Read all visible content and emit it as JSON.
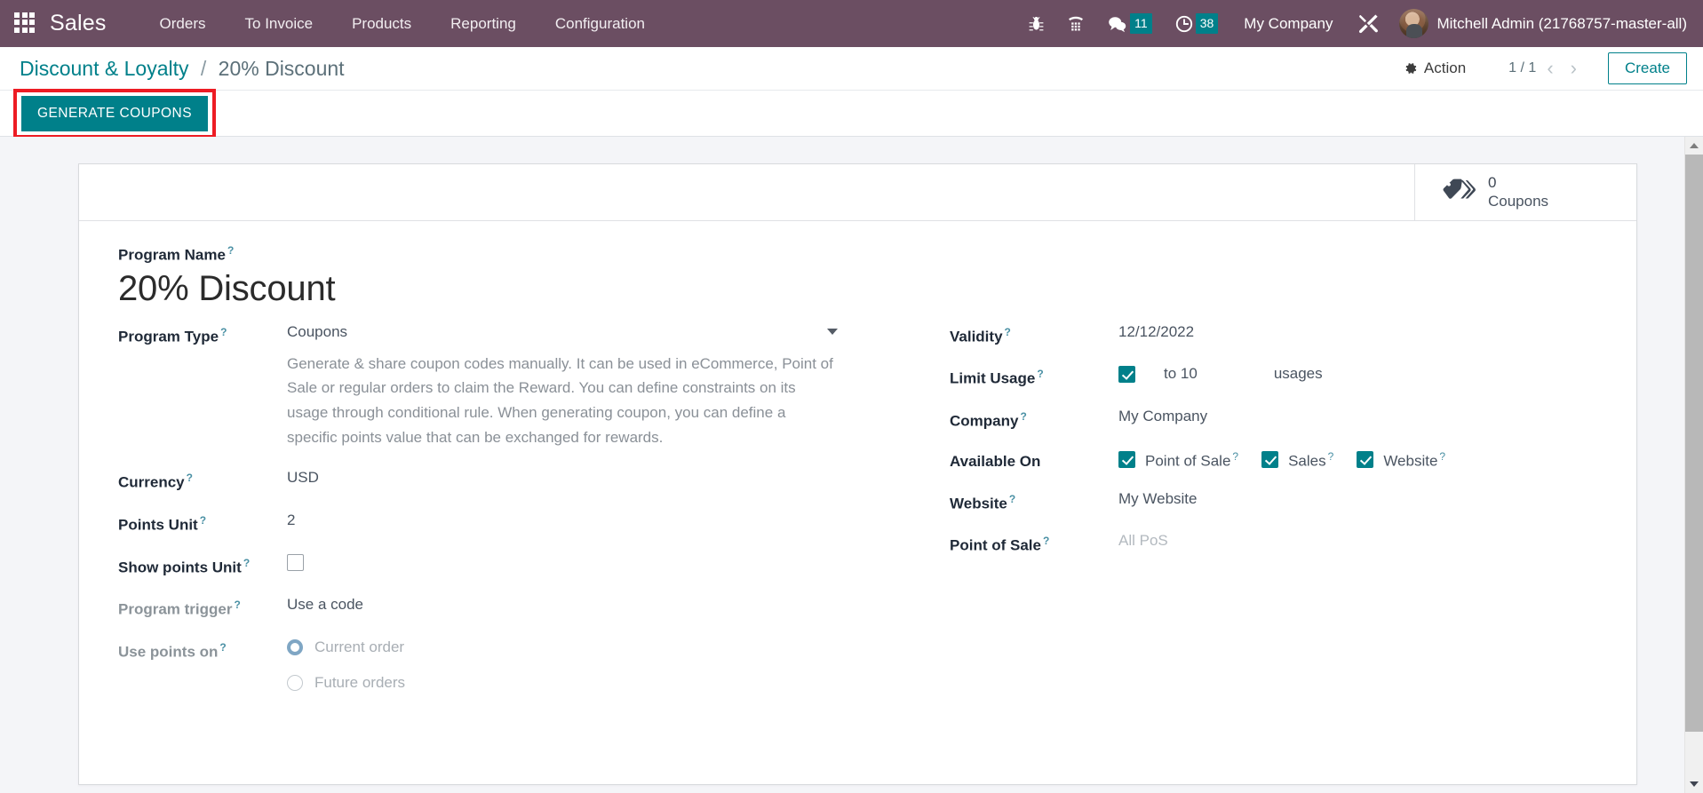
{
  "navbar": {
    "apps_icon": "apps-grid-icon",
    "brand": "Sales",
    "menu": [
      {
        "label": "Orders"
      },
      {
        "label": "To Invoice"
      },
      {
        "label": "Products"
      },
      {
        "label": "Reporting"
      },
      {
        "label": "Configuration"
      }
    ],
    "icons": [
      {
        "name": "bug-icon",
        "glyph": "\u0001"
      },
      {
        "name": "phone-icon",
        "glyph": "\u0001"
      }
    ],
    "messages_badge": "11",
    "activities_badge": "38",
    "company": "My Company",
    "tools_icon": "wrench-screwdriver-icon",
    "user_name": "Mitchell Admin (21768757-master-all)"
  },
  "control_panel": {
    "breadcrumb_root": "Discount & Loyalty",
    "breadcrumb_sep": "/",
    "breadcrumb_current": "20% Discount",
    "action_label": "Action",
    "pager": "1 / 1",
    "prev_arrow": "‹",
    "next_arrow": "›",
    "create_label": "Create",
    "generate_coupons_label": "GENERATE COUPONS"
  },
  "stat_buttons": [
    {
      "icon": "tag-icon",
      "value": "0",
      "label": "Coupons"
    }
  ],
  "form": {
    "program_name_label": "Program Name",
    "program_name_value": "20% Discount",
    "left": {
      "program_type_label": "Program Type",
      "program_type_value": "Coupons",
      "program_type_description": "Generate & share coupon codes manually. It can be used in eCommerce, Point of Sale or regular orders to claim the Reward. You can define constraints on its usage through conditional rule. When generating coupon, you can define a specific points value that can be exchanged for rewards.",
      "currency_label": "Currency",
      "currency_value": "USD",
      "points_unit_label": "Points Unit",
      "points_unit_value": "2",
      "show_points_unit_label": "Show points Unit",
      "show_points_unit_checked": false,
      "program_trigger_label": "Program trigger",
      "program_trigger_value": "Use a code",
      "use_points_on_label": "Use points on",
      "use_points_options": [
        {
          "label": "Current order",
          "selected": true
        },
        {
          "label": "Future orders",
          "selected": false
        }
      ]
    },
    "right": {
      "validity_label": "Validity",
      "validity_value": "12/12/2022",
      "limit_usage_label": "Limit Usage",
      "limit_usage_checked": true,
      "limit_usage_to": "to 10",
      "limit_usage_unit": "usages",
      "company_label": "Company",
      "company_value": "My Company",
      "available_on_label": "Available On",
      "available_on": [
        {
          "label": "Point of Sale",
          "checked": true
        },
        {
          "label": "Sales",
          "checked": true
        },
        {
          "label": "Website",
          "checked": true
        }
      ],
      "website_label": "Website",
      "website_value": "My Website",
      "point_of_sale_label": "Point of Sale",
      "point_of_sale_placeholder": "All PoS"
    }
  },
  "colors": {
    "navbar_bg": "#6b4e62",
    "accent": "#00808a",
    "highlight_box": "#ed1c24",
    "badge": "#00808a",
    "page_bg": "#f4f5f8"
  }
}
